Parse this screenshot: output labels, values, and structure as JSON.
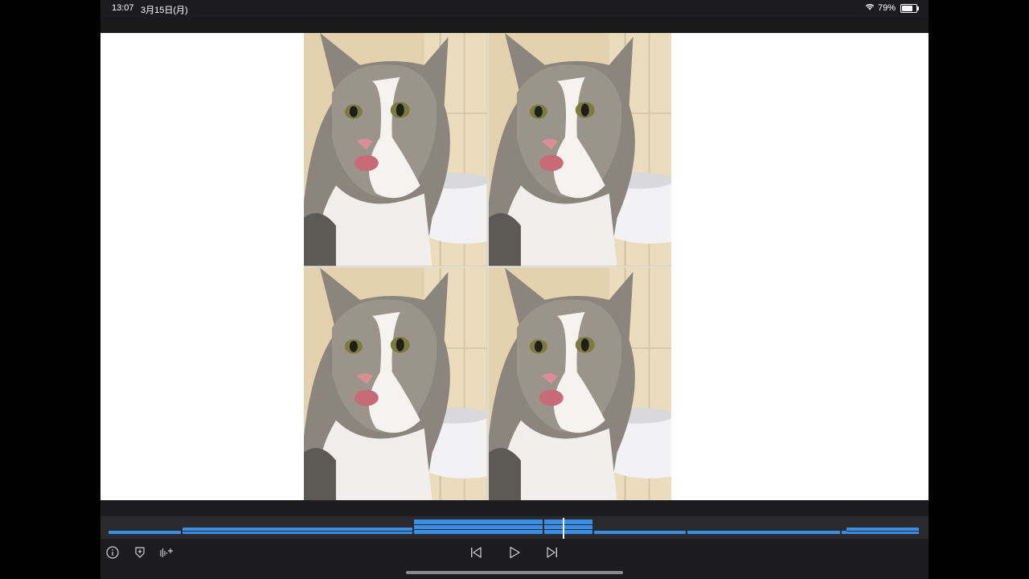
{
  "status": {
    "time": "13:07",
    "date": "3月15日(月)",
    "battery_percent": "79%",
    "battery_level": 0.79
  },
  "viewer": {
    "tiles": [
      {
        "id": "tile-1"
      },
      {
        "id": "tile-2"
      },
      {
        "id": "tile-3"
      },
      {
        "id": "tile-4"
      }
    ]
  },
  "timeline": {
    "accent_color": "#3a8ee6",
    "playhead_position": 0.56
  },
  "controls": {
    "left": [
      {
        "name": "info-icon"
      },
      {
        "name": "add-marker-icon"
      },
      {
        "name": "add-audio-icon"
      }
    ],
    "center": [
      {
        "name": "skip-back-icon"
      },
      {
        "name": "play-icon"
      },
      {
        "name": "skip-forward-icon"
      }
    ]
  }
}
